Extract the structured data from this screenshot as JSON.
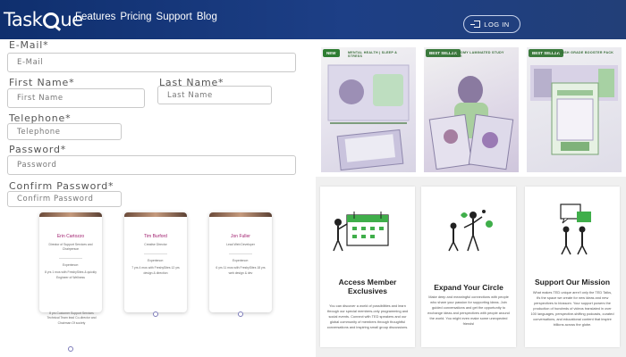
{
  "header": {
    "logo": "TaskQue",
    "nav": [
      "Features",
      "Pricing",
      "Support",
      "Blog"
    ],
    "login_label": "LOG IN"
  },
  "form": {
    "email_label": "E-Mail*",
    "email_placeholder": "E-Mail",
    "first_name_label": "First Name*",
    "first_name_placeholder": "First Name",
    "last_name_label": "Last Name*",
    "last_name_placeholder": "Last Name",
    "telephone_label": "Telephone*",
    "telephone_placeholder": "Telephone",
    "password_label": "Password*",
    "password_placeholder": "Password",
    "confirm_label": "Confirm Password*",
    "confirm_placeholder": "Confirm Password"
  },
  "team": [
    {
      "name": "Erin Cartozzo",
      "role": "Director of Support Services and Chairperson",
      "exp_title": "Experience:",
      "exp": "8 yrs 1 mos with FreshySites & quickly Engineer of Wellness",
      "overflow": "8 yrs Customer Support Services Technical Team lead Co-director and Chairman Of society"
    },
    {
      "name": "Tim Burford",
      "role": "Creative Director",
      "exp_title": "Experience:",
      "exp": "7 yrs 4 mos with FreshySites 12 yrs design & direction"
    },
    {
      "name": "Jon Fuller",
      "role": "Lead Web Developer",
      "exp_title": "Experience:",
      "exp": "6 yrs 11 mos with FreshySites 18 yrs web design & dev"
    }
  ],
  "products": [
    {
      "badge": "NEW",
      "title": "MENTAL HEALTH | SLEEP & STRESS"
    },
    {
      "badge": "BEST SELLER",
      "title": "ANATOMY LAMINATED STUDY GUIDE"
    },
    {
      "badge": "BEST SELLER",
      "title": "SPANISH GRADE BOOSTER PACK"
    }
  ],
  "features": [
    {
      "title": "Access Member Exclusives",
      "body": "You can discover a world of possibilities and learn through our special members-only programming and social events. Connect with TED speakers and our global community of members through thoughtful conversations and inspiring small group discussions."
    },
    {
      "title": "Expand Your Circle",
      "body": "Make deep and meaningful connections with people who share your passion for supporting ideas. Join guided conversations and get the opportunity to exchange ideas and perspectives with people around the world. You might even make some unexpected friends!"
    },
    {
      "title": "Support Our Mission",
      "body": "What makes TED unique aren't only the TED Talks, it's the space we create for new ideas and new perspectives to blossom. Your support powers the production of hundreds of videos translated in over 100 languages, perspective-shifting podcasts, curated conversations, and educational content that inspire billions across the globe."
    }
  ],
  "colors": {
    "header": "#1d3f86",
    "accent": "#a01e6e",
    "badge_green": "#2e7d32"
  }
}
